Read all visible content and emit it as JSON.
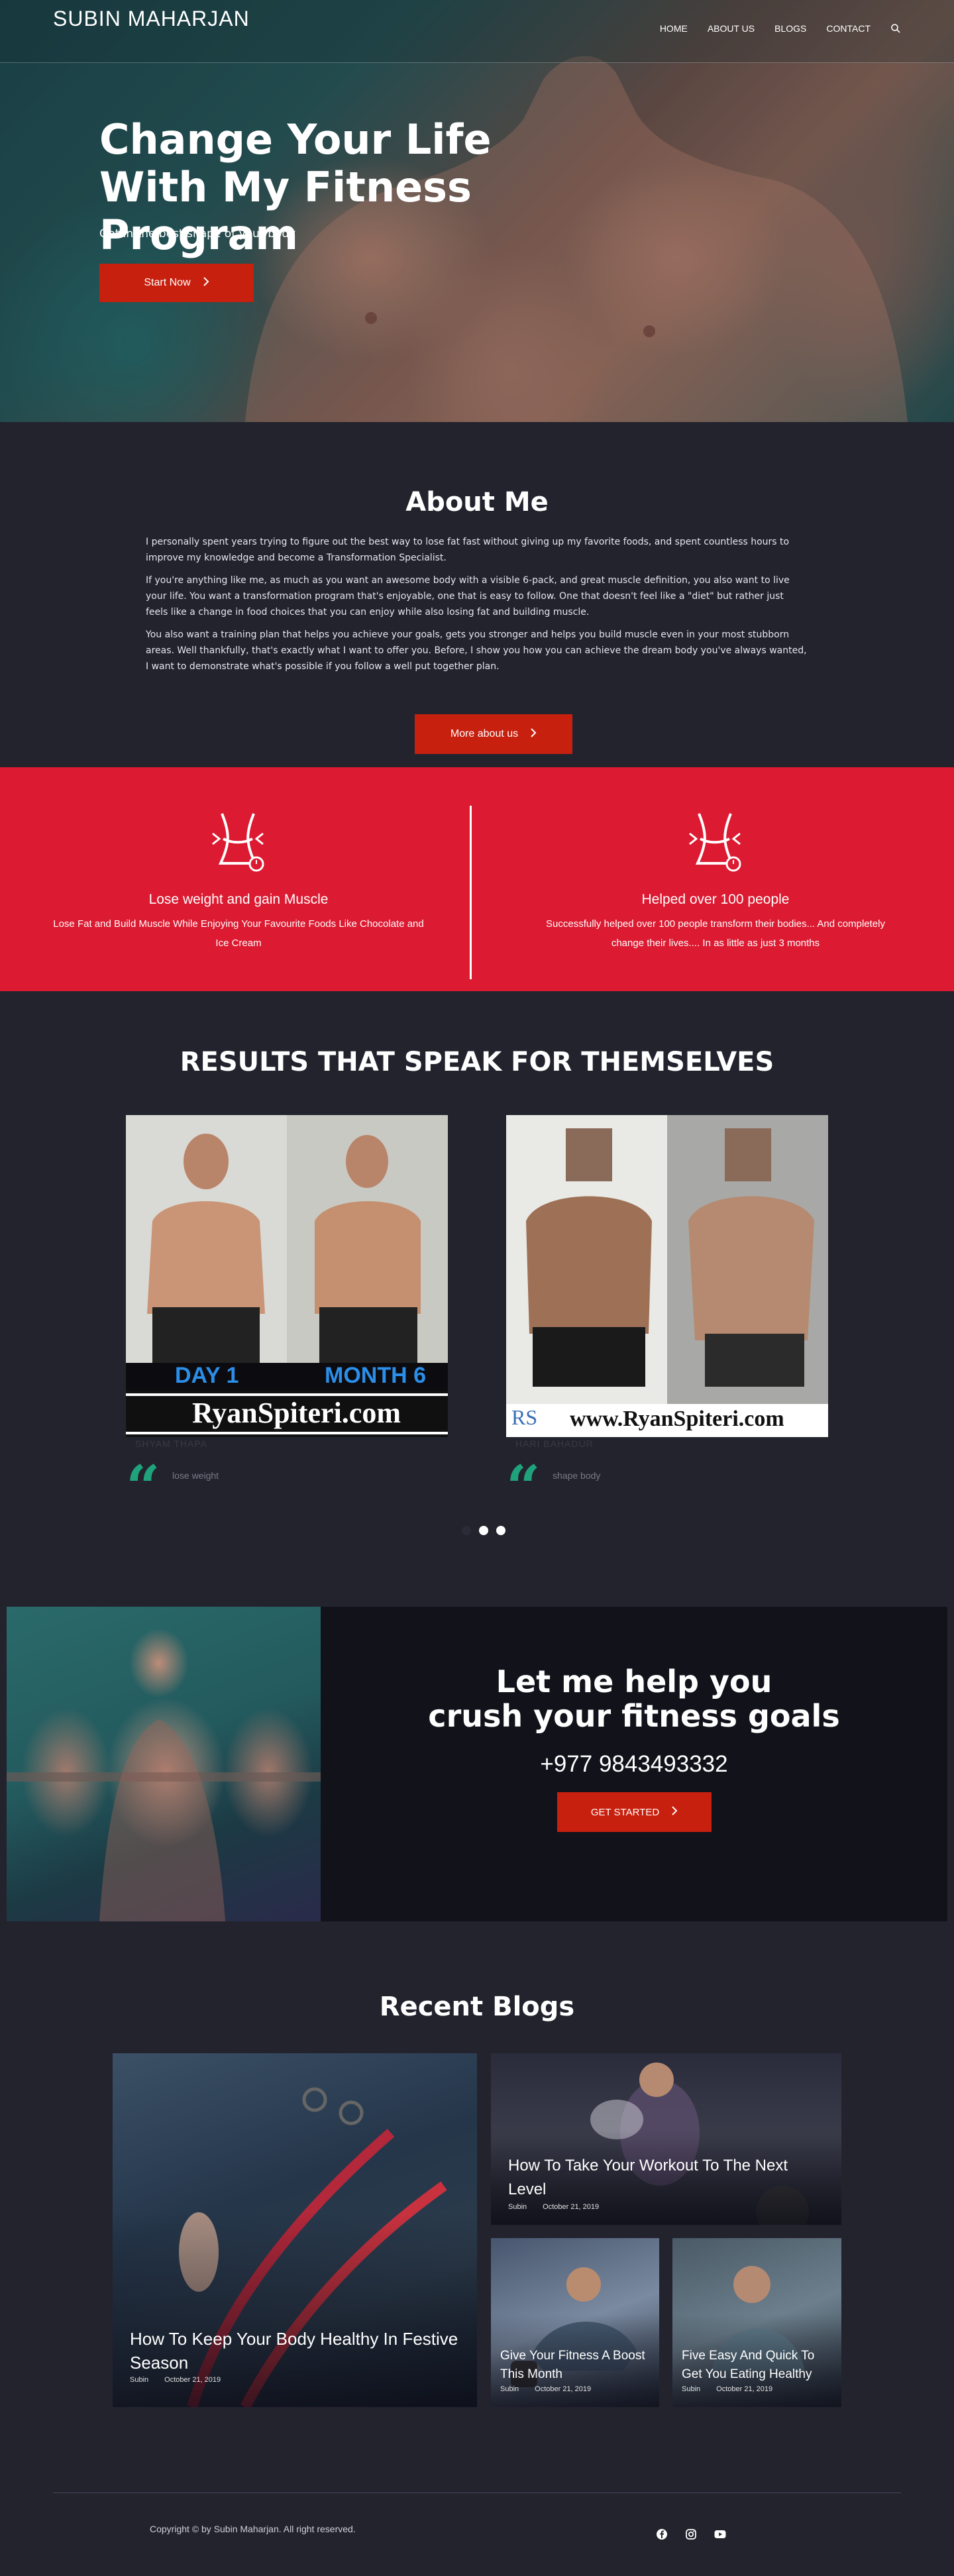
{
  "header": {
    "brand": "SUBIN MAHARJAN",
    "nav": [
      "HOME",
      "ABOUT US",
      "BLOGS",
      "CONTACT"
    ]
  },
  "hero": {
    "title": "Change Your Life With My Fitness Program",
    "subtitle": "Get in the best shape of your body",
    "button": "Start Now"
  },
  "about": {
    "title": "About Me",
    "paragraphs": [
      "I personally spent years trying to figure out the best way to lose fat fast without giving up my favorite foods, and spent countless hours to improve my knowledge and become a Transformation Specialist.",
      "If you're anything like me, as much as you want an awesome body with a visible 6-pack, and great muscle definition, you also want to live your life. You want a transformation program that's enjoyable, one that is easy to follow. One that doesn't feel like a \"diet\" but rather just feels like a change in food choices that you can enjoy while also losing fat and building muscle.",
      "You also want a training plan that helps you achieve your goals, gets you stronger and helps you build muscle even in your most stubborn areas. Well thankfully, that's exactly what I want to offer you. Before, I show you how you can achieve the dream body you've always wanted, I want to demonstrate what's possible if you follow a well put together plan."
    ],
    "button": "More about us"
  },
  "features": [
    {
      "title": "Lose weight and gain Muscle",
      "desc": "Lose Fat and Build Muscle While Enjoying Your Favourite Foods Like Chocolate and Ice Cream",
      "icon": "waist-measure-icon"
    },
    {
      "title": "Helped over 100 people",
      "desc": "Successfully helped over 100 people transform their bodies... And completely change their lives.... In as little as just 3 months",
      "icon": "waist-measure-icon"
    }
  ],
  "results": {
    "title": "RESULTS THAT SPEAK FOR THEMSELVES",
    "items": [
      {
        "name": "SHYAM THAPA",
        "quote": "lose weight",
        "label_left": "DAY 1",
        "label_right": "MONTH 6",
        "banner": "RyanSpiteri.com"
      },
      {
        "name": "HARI BAHADUR",
        "quote": "shape body",
        "banner": "www.RyanSpiteri.com",
        "banner_logo": "RS"
      }
    ],
    "pagination": {
      "active": 1,
      "total": 3
    }
  },
  "cta": {
    "title_line1": "Let me help you",
    "title_line2": "crush your fitness goals",
    "phone": "+977 9843493332",
    "button": "GET STARTED"
  },
  "blogs": {
    "title": "Recent Blogs",
    "posts": [
      {
        "title": "How To Keep Your Body Healthy In Festive Season",
        "author": "Subin",
        "date": "October 21, 2019"
      },
      {
        "title": "How To Take Your Workout To The Next Level",
        "author": "Subin",
        "date": "October 21, 2019"
      },
      {
        "title": "Give Your Fitness A Boost This Month",
        "author": "Subin",
        "date": "October 21, 2019"
      },
      {
        "title": "Five Easy And Quick To Get You Eating Healthy",
        "author": "Subin",
        "date": "October 21, 2019"
      }
    ]
  },
  "footer": {
    "copyright": "Copyright © by Subin Maharjan. All right reserved.",
    "social": [
      "facebook-icon",
      "instagram-icon",
      "youtube-icon"
    ]
  },
  "colors": {
    "accent": "#c8200e",
    "feature_band": "#dc1a31",
    "background": "#23232e",
    "quote": "#1fa37c"
  }
}
